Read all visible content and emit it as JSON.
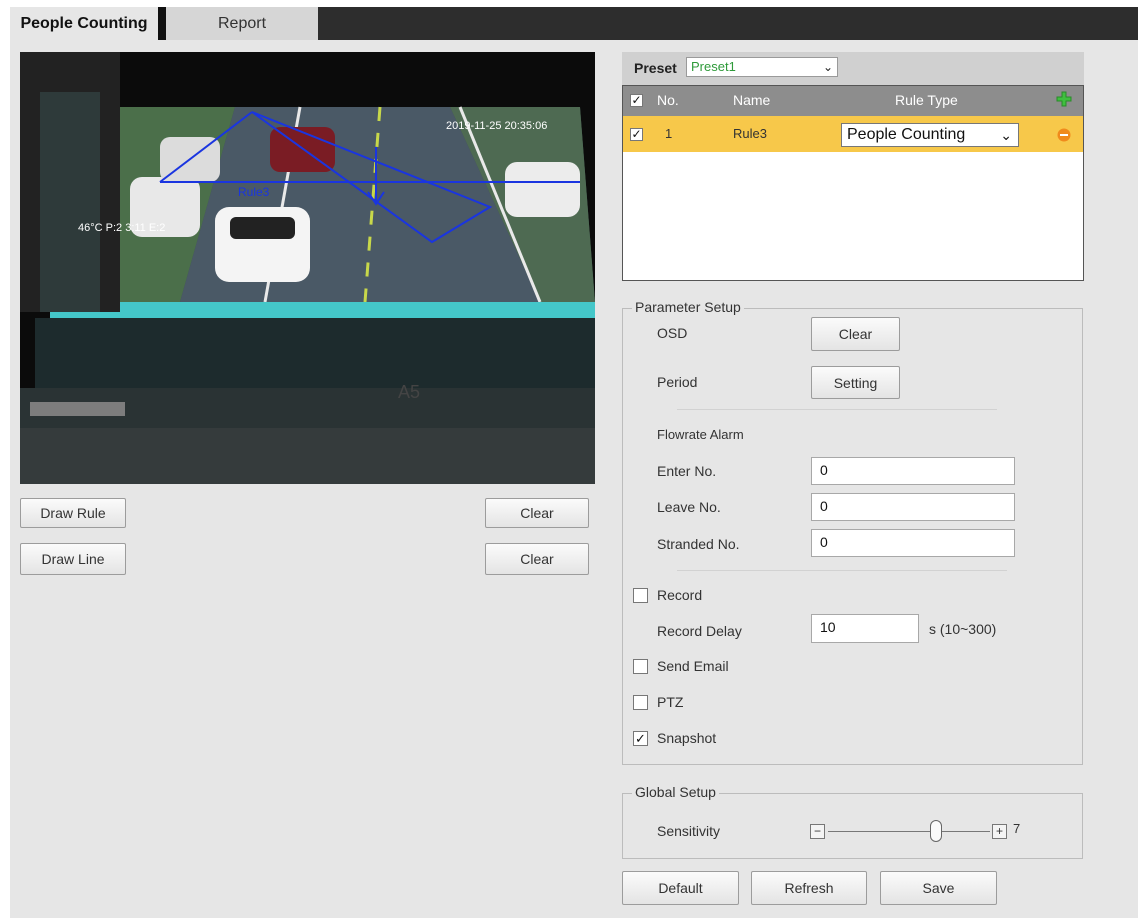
{
  "tabs": {
    "active": "People Counting",
    "inactive": "Report"
  },
  "video": {
    "timestamp": "2019-11-25 20:35:06",
    "rule_label": "Rule3",
    "overlay_left": "46°C P:2 3:11 E:2",
    "plate": "A5"
  },
  "left_buttons": {
    "draw_rule": "Draw Rule",
    "clear_rule": "Clear",
    "draw_line": "Draw Line",
    "clear_line": "Clear"
  },
  "preset": {
    "label": "Preset",
    "value": "Preset1"
  },
  "rule_table": {
    "headers": {
      "no": "No.",
      "name": "Name",
      "rule_type": "Rule Type"
    },
    "rows": [
      {
        "no": "1",
        "name": "Rule3",
        "rule_type": "People Counting"
      }
    ]
  },
  "parameter_setup": {
    "legend": "Parameter Setup",
    "osd_label": "OSD",
    "osd_button": "Clear",
    "period_label": "Period",
    "period_button": "Setting",
    "flowrate_label": "Flowrate Alarm",
    "enter_label": "Enter No.",
    "enter_value": "0",
    "leave_label": "Leave No.",
    "leave_value": "0",
    "stranded_label": "Stranded No.",
    "stranded_value": "0",
    "record_label": "Record",
    "record_delay_label": "Record Delay",
    "record_delay_value": "10",
    "record_delay_unit": "s (10~300)",
    "send_email_label": "Send Email",
    "ptz_label": "PTZ",
    "snapshot_label": "Snapshot"
  },
  "global_setup": {
    "legend": "Global Setup",
    "sensitivity_label": "Sensitivity",
    "sensitivity_value": "7",
    "sensitivity_min": 1,
    "sensitivity_max": 10
  },
  "footer": {
    "default": "Default",
    "refresh": "Refresh",
    "save": "Save"
  },
  "colors": {
    "rule_highlight": "#f7c84a",
    "add_icon": "#3fbf3f",
    "remove_icon": "#f08a1c",
    "rule_overlay": "#1a35e0"
  }
}
